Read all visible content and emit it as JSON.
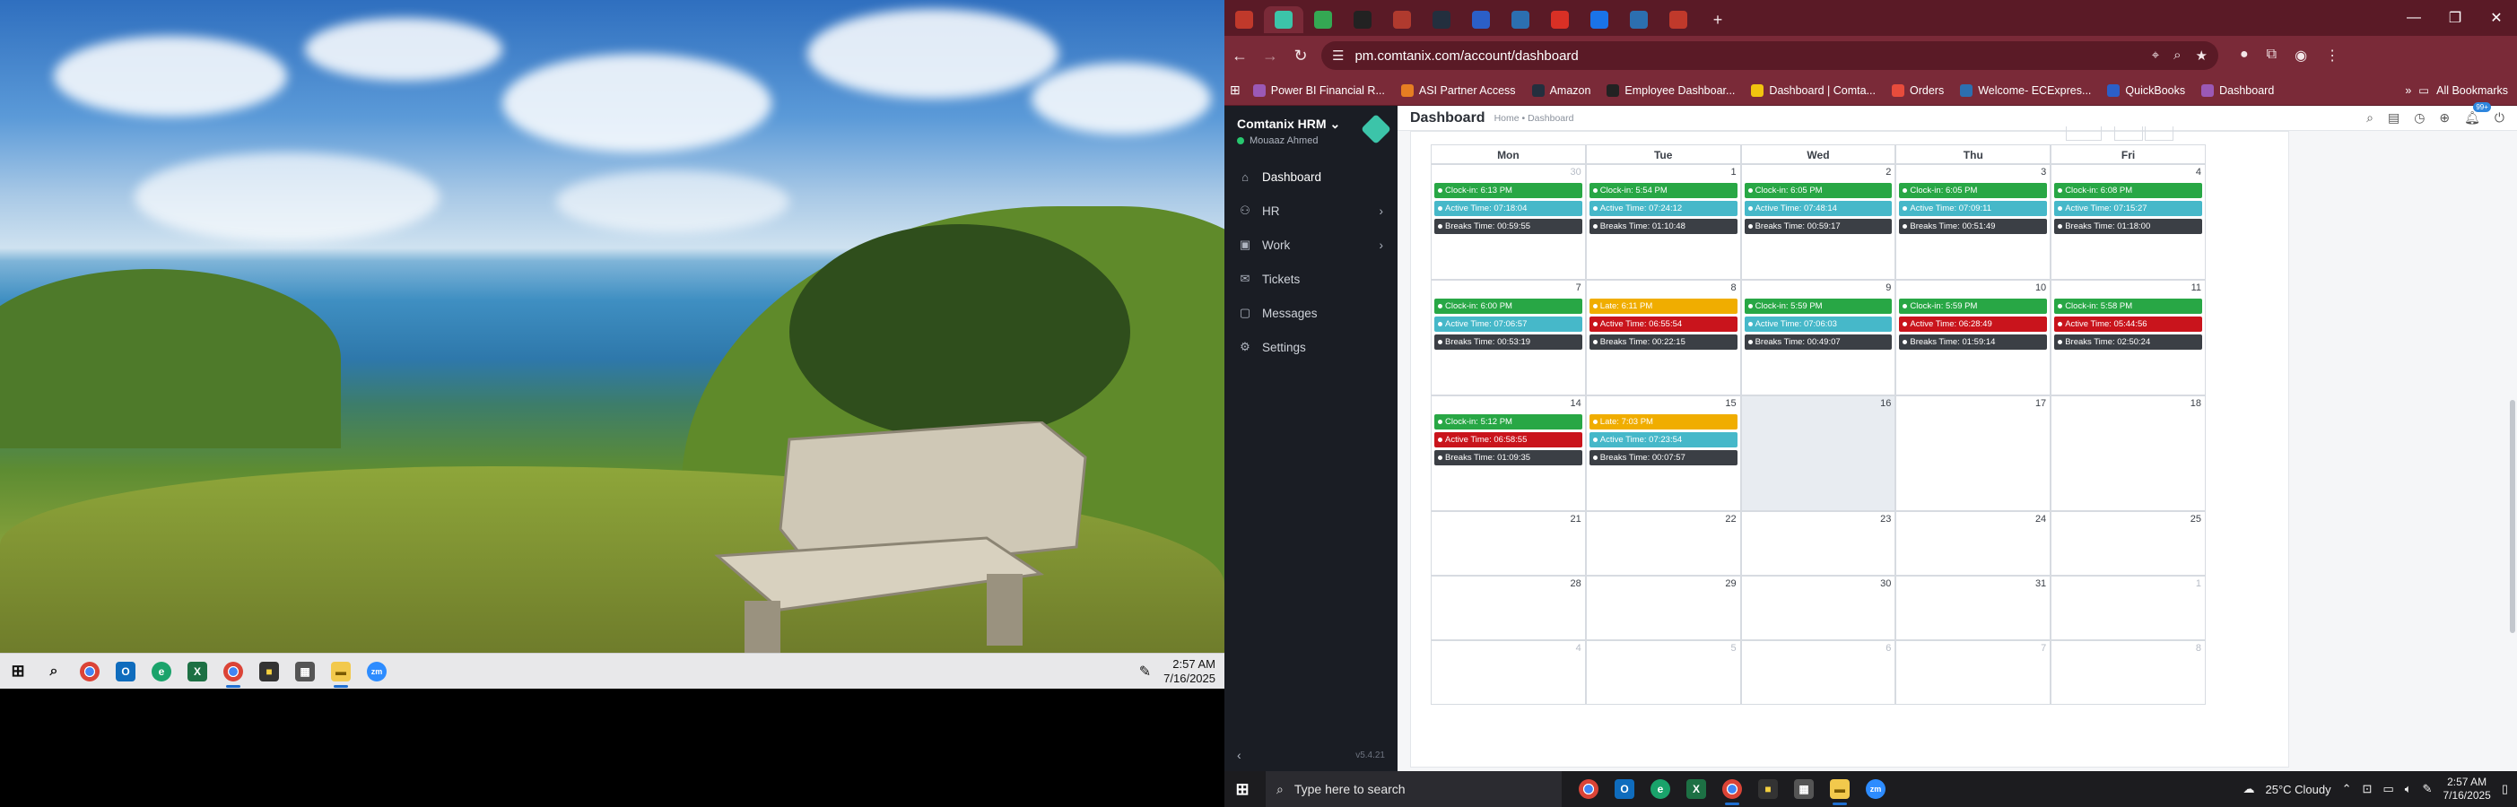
{
  "left_taskbar": {
    "apps": [
      "start-icon",
      "search-icon",
      "chrome-icon",
      "outlook-icon",
      "edge-icon",
      "excel-icon",
      "chrome-icon",
      "sticky-notes-icon",
      "calculator-icon",
      "file-explorer-icon",
      "zoom-icon"
    ],
    "time": "2:57 AM",
    "date": "7/16/2025"
  },
  "browser": {
    "tabs": [
      {
        "icon": "tab-list-icon",
        "color": "#c0392b"
      },
      {
        "icon": "comtanix-icon",
        "color": "#3cc4a9",
        "active": true
      },
      {
        "icon": "chrome-icon",
        "color": "#34a853"
      },
      {
        "icon": "asi-icon",
        "color": "#222222"
      },
      {
        "icon": "ticket-icon",
        "color": "#b03a2e"
      },
      {
        "icon": "amazon-icon",
        "color": "#232f3e"
      },
      {
        "icon": "quickbooks-icon",
        "color": "#2b5fc7"
      },
      {
        "icon": "ec-icon",
        "color": "#2c6fb0"
      },
      {
        "icon": "gmail-icon",
        "color": "#d93025"
      },
      {
        "icon": "docs-icon",
        "color": "#1a73e8"
      },
      {
        "icon": "ec-icon",
        "color": "#2c6fb0"
      },
      {
        "icon": "pdf-icon",
        "color": "#c0392b"
      }
    ],
    "url": "pm.comtanix.com/account/dashboard",
    "bookmarks": [
      {
        "label": "Power BI Financial R...",
        "color": "#9b59b6"
      },
      {
        "label": "ASI Partner Access",
        "color": "#e67e22"
      },
      {
        "label": "Amazon",
        "color": "#232f3e"
      },
      {
        "label": "Employee Dashboar...",
        "color": "#222222"
      },
      {
        "label": "Dashboard | Comta...",
        "color": "#f1c40f"
      },
      {
        "label": "Orders",
        "color": "#e74c3c"
      },
      {
        "label": "Welcome- ECExpres...",
        "color": "#2c6fb0"
      },
      {
        "label": "QuickBooks",
        "color": "#2b5fc7"
      },
      {
        "label": "Dashboard",
        "color": "#9b59b6"
      }
    ],
    "all_bookmarks": "All Bookmarks"
  },
  "sidebar": {
    "brand": "Comtanix HRM",
    "user": "Mouaaz Ahmed",
    "items": [
      {
        "label": "Dashboard",
        "icon": "home-icon",
        "active": true,
        "chevron": false
      },
      {
        "label": "HR",
        "icon": "users-icon",
        "chevron": true
      },
      {
        "label": "Work",
        "icon": "briefcase-icon",
        "chevron": true
      },
      {
        "label": "Tickets",
        "icon": "ticket-icon",
        "chevron": false
      },
      {
        "label": "Messages",
        "icon": "message-icon",
        "chevron": false
      },
      {
        "label": "Settings",
        "icon": "gear-icon",
        "chevron": false
      }
    ],
    "version": "v5.4.21"
  },
  "topbar": {
    "title": "Dashboard",
    "breadcrumb": "Home • Dashboard",
    "notification_count": "99+"
  },
  "calendar": {
    "headers": [
      "Mon",
      "Tue",
      "Wed",
      "Thu",
      "Fri"
    ],
    "colors": {
      "clockin": "#28a745",
      "late": "#f0ad00",
      "active_ok": "#46b8c9",
      "active_low": "#c9141c",
      "breaks": "#3b3f45"
    },
    "weeks": [
      [
        {
          "day": "30",
          "muted": true,
          "events": [
            {
              "type": "clockin",
              "text": "Clock-in: 6:13 PM"
            },
            {
              "type": "active_ok",
              "text": "Active Time: 07:18:04"
            },
            {
              "type": "breaks",
              "text": "Breaks Time: 00:59:55"
            }
          ]
        },
        {
          "day": "1",
          "events": [
            {
              "type": "clockin",
              "text": "Clock-in: 5:54 PM"
            },
            {
              "type": "active_ok",
              "text": "Active Time: 07:24:12"
            },
            {
              "type": "breaks",
              "text": "Breaks Time: 01:10:48"
            }
          ]
        },
        {
          "day": "2",
          "events": [
            {
              "type": "clockin",
              "text": "Clock-in: 6:05 PM"
            },
            {
              "type": "active_ok",
              "text": "Active Time: 07:48:14"
            },
            {
              "type": "breaks",
              "text": "Breaks Time: 00:59:17"
            }
          ]
        },
        {
          "day": "3",
          "events": [
            {
              "type": "clockin",
              "text": "Clock-in: 6:05 PM"
            },
            {
              "type": "active_ok",
              "text": "Active Time: 07:09:11"
            },
            {
              "type": "breaks",
              "text": "Breaks Time: 00:51:49"
            }
          ]
        },
        {
          "day": "4",
          "events": [
            {
              "type": "clockin",
              "text": "Clock-in: 6:08 PM"
            },
            {
              "type": "active_ok",
              "text": "Active Time: 07:15:27"
            },
            {
              "type": "breaks",
              "text": "Breaks Time: 01:18:00"
            }
          ]
        }
      ],
      [
        {
          "day": "7",
          "events": [
            {
              "type": "clockin",
              "text": "Clock-in: 6:00 PM"
            },
            {
              "type": "active_ok",
              "text": "Active Time: 07:06:57"
            },
            {
              "type": "breaks",
              "text": "Breaks Time: 00:53:19"
            }
          ]
        },
        {
          "day": "8",
          "events": [
            {
              "type": "late",
              "text": "Late: 6:11 PM"
            },
            {
              "type": "active_low",
              "text": "Active Time: 06:55:54"
            },
            {
              "type": "breaks",
              "text": "Breaks Time: 00:22:15"
            }
          ]
        },
        {
          "day": "9",
          "events": [
            {
              "type": "clockin",
              "text": "Clock-in: 5:59 PM"
            },
            {
              "type": "active_ok",
              "text": "Active Time: 07:06:03"
            },
            {
              "type": "breaks",
              "text": "Breaks Time: 00:49:07"
            }
          ]
        },
        {
          "day": "10",
          "events": [
            {
              "type": "clockin",
              "text": "Clock-in: 5:59 PM"
            },
            {
              "type": "active_low",
              "text": "Active Time: 06:28:49"
            },
            {
              "type": "breaks",
              "text": "Breaks Time: 01:59:14"
            }
          ]
        },
        {
          "day": "11",
          "events": [
            {
              "type": "clockin",
              "text": "Clock-in: 5:58 PM"
            },
            {
              "type": "active_low",
              "text": "Active Time: 05:44:56"
            },
            {
              "type": "breaks",
              "text": "Breaks Time: 02:50:24"
            }
          ]
        }
      ],
      [
        {
          "day": "14",
          "events": [
            {
              "type": "clockin",
              "text": "Clock-in: 5:12 PM"
            },
            {
              "type": "active_low",
              "text": "Active Time: 06:58:55"
            },
            {
              "type": "breaks",
              "text": "Breaks Time: 01:09:35"
            }
          ]
        },
        {
          "day": "15",
          "events": [
            {
              "type": "late",
              "text": "Late: 7:03 PM"
            },
            {
              "type": "active_ok",
              "text": "Active Time: 07:23:54"
            },
            {
              "type": "breaks",
              "text": "Breaks Time: 00:07:57"
            }
          ]
        },
        {
          "day": "16",
          "today": true,
          "events": []
        },
        {
          "day": "17",
          "events": []
        },
        {
          "day": "18",
          "events": []
        }
      ],
      [
        {
          "day": "21",
          "events": []
        },
        {
          "day": "22",
          "events": []
        },
        {
          "day": "23",
          "events": []
        },
        {
          "day": "24",
          "events": []
        },
        {
          "day": "25",
          "events": []
        }
      ],
      [
        {
          "day": "28",
          "events": []
        },
        {
          "day": "29",
          "events": []
        },
        {
          "day": "30",
          "events": []
        },
        {
          "day": "31",
          "events": []
        },
        {
          "day": "1",
          "muted": true,
          "events": []
        }
      ],
      [
        {
          "day": "4",
          "muted": true,
          "events": []
        },
        {
          "day": "5",
          "muted": true,
          "events": []
        },
        {
          "day": "6",
          "muted": true,
          "events": []
        },
        {
          "day": "7",
          "muted": true,
          "events": []
        },
        {
          "day": "8",
          "muted": true,
          "events": []
        }
      ]
    ]
  },
  "right_taskbar": {
    "search_placeholder": "Type here to search",
    "weather": "25°C  Cloudy",
    "time": "2:57 AM",
    "date": "7/16/2025"
  }
}
